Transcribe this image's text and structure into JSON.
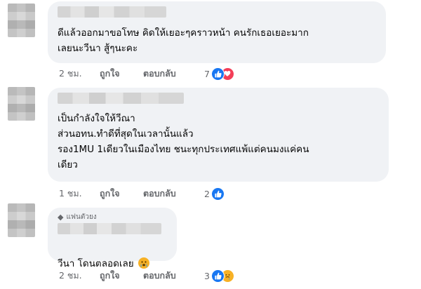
{
  "comments": [
    {
      "lines": "ดีแล้วออกมาขอโทษ คิดให้เยอะๆคราวหน้า คนรักเธอเยอะมาก\nเลยนะวีนา สู้ๆนะคะ",
      "time": "2 ชม.",
      "like_label": "ถูกใจ",
      "reply_label": "ตอบกลับ",
      "reaction_count": "7",
      "reactions": [
        "like-icon",
        "love-icon"
      ]
    },
    {
      "lines": "เป็นกำลังใจให้วีณา\nส่วนอทน.ทำดีที่สุดในเวลานั้นแล้ว\nรอง1MU 1เดียวในเมืองไทย ชนะทุกประเทศแพ้แต่คนมงแค่คน\nเดียว",
      "time": "1 ชม.",
      "like_label": "ถูกใจ",
      "reply_label": "ตอบกลับ",
      "reaction_count": "2",
      "reactions": [
        "like-icon"
      ]
    },
    {
      "badge": "แฟนตัวยง",
      "lines": "วีนา โดนตลอดเลย",
      "emoji": "crying-face-emoji",
      "time": "2 ชม.",
      "like_label": "ถูกใจ",
      "reply_label": "ตอบกลับ",
      "reaction_count": "3",
      "reactions": [
        "like-icon",
        "care-icon"
      ]
    }
  ],
  "colors": {
    "bubble": "#f0f2f5",
    "meta_text": "#65676b",
    "like_blue": "#1877f2",
    "love_red": "#f33e58",
    "care_yellow": "#f7b125"
  }
}
